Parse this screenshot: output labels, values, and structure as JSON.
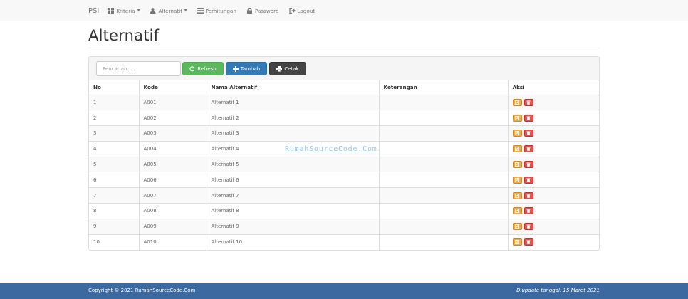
{
  "navbar": {
    "brand": "PSI",
    "items": [
      {
        "label": "Kriteria",
        "icon": "grid-icon",
        "dropdown": true
      },
      {
        "label": "Alternatif",
        "icon": "user-icon",
        "dropdown": true
      },
      {
        "label": "Perhitungan",
        "icon": "list-icon",
        "dropdown": false
      },
      {
        "label": "Password",
        "icon": "lock-icon",
        "dropdown": false
      },
      {
        "label": "Logout",
        "icon": "logout-icon",
        "dropdown": false
      }
    ]
  },
  "page": {
    "title": "Alternatif"
  },
  "toolbar": {
    "search_placeholder": "Pencarian. . .",
    "refresh_label": "Refresh",
    "tambah_label": "Tambah",
    "cetak_label": "Cetak"
  },
  "table": {
    "columns": [
      "No",
      "Kode",
      "Nama Alternatif",
      "Keterangan",
      "Aksi"
    ],
    "rows": [
      {
        "no": "1",
        "kode": "A001",
        "nama": "Alternatif 1",
        "keterangan": ""
      },
      {
        "no": "2",
        "kode": "A002",
        "nama": "Alternatif 2",
        "keterangan": ""
      },
      {
        "no": "3",
        "kode": "A003",
        "nama": "Alternatif 3",
        "keterangan": ""
      },
      {
        "no": "4",
        "kode": "A004",
        "nama": "Alternatif 4",
        "keterangan": ""
      },
      {
        "no": "5",
        "kode": "A005",
        "nama": "Alternatif 5",
        "keterangan": ""
      },
      {
        "no": "6",
        "kode": "A006",
        "nama": "Alternatif 6",
        "keterangan": ""
      },
      {
        "no": "7",
        "kode": "A007",
        "nama": "Alternatif 7",
        "keterangan": ""
      },
      {
        "no": "8",
        "kode": "A008",
        "nama": "Alternatif 8",
        "keterangan": ""
      },
      {
        "no": "9",
        "kode": "A009",
        "nama": "Alternatif 9",
        "keterangan": ""
      },
      {
        "no": "10",
        "kode": "A010",
        "nama": "Alternatif 10",
        "keterangan": ""
      }
    ]
  },
  "watermark": "RumahSourceCode.Com",
  "footer": {
    "copyright": "Copyright © 2021 RumahSourceCode.Com",
    "updated": "Diupdate tanggal: 15 Maret 2021"
  },
  "colors": {
    "refresh": "#5cb85c",
    "tambah": "#337ab7",
    "cetak": "#444444",
    "edit": "#f0ad4e",
    "delete": "#d9534f",
    "footer": "#3c6aa0"
  }
}
